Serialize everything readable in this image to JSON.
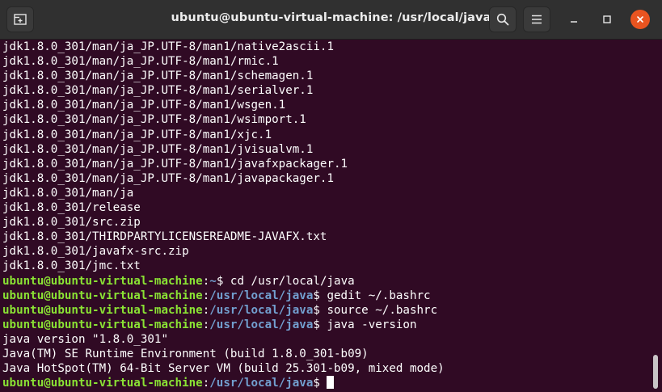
{
  "window": {
    "title": "ubuntu@ubuntu-virtual-machine: /usr/local/java"
  },
  "icons": {
    "new_tab": "new-tab-icon",
    "search": "search-icon",
    "menu": "hamburger-menu-icon",
    "minimize": "minimize-icon",
    "maximize": "maximize-icon",
    "close": "close-icon"
  },
  "colors": {
    "terminal_bg": "#300a24",
    "user_host": "#8ae234",
    "path": "#729fcf",
    "close_button": "#e95420"
  },
  "terminal": {
    "output_lines": [
      "jdk1.8.0_301/man/ja_JP.UTF-8/man1/native2ascii.1",
      "jdk1.8.0_301/man/ja_JP.UTF-8/man1/rmic.1",
      "jdk1.8.0_301/man/ja_JP.UTF-8/man1/schemagen.1",
      "jdk1.8.0_301/man/ja_JP.UTF-8/man1/serialver.1",
      "jdk1.8.0_301/man/ja_JP.UTF-8/man1/wsgen.1",
      "jdk1.8.0_301/man/ja_JP.UTF-8/man1/wsimport.1",
      "jdk1.8.0_301/man/ja_JP.UTF-8/man1/xjc.1",
      "jdk1.8.0_301/man/ja_JP.UTF-8/man1/jvisualvm.1",
      "jdk1.8.0_301/man/ja_JP.UTF-8/man1/javafxpackager.1",
      "jdk1.8.0_301/man/ja_JP.UTF-8/man1/javapackager.1",
      "jdk1.8.0_301/man/ja",
      "jdk1.8.0_301/release",
      "jdk1.8.0_301/src.zip",
      "jdk1.8.0_301/THIRDPARTYLICENSEREADME-JAVAFX.txt",
      "jdk1.8.0_301/javafx-src.zip",
      "jdk1.8.0_301/jmc.txt"
    ],
    "prompt_user": "ubuntu@ubuntu-virtual-machine",
    "commands": [
      {
        "path": "~",
        "cmd": " cd /usr/local/java"
      },
      {
        "path": "/usr/local/java",
        "cmd": " gedit ~/.bashrc"
      },
      {
        "path": "/usr/local/java",
        "cmd": " source ~/.bashrc"
      },
      {
        "path": "/usr/local/java",
        "cmd": " java -version"
      }
    ],
    "version_output": [
      "java version \"1.8.0_301\"",
      "Java(TM) SE Runtime Environment (build 1.8.0_301-b09)",
      "Java HotSpot(TM) 64-Bit Server VM (build 25.301-b09, mixed mode)"
    ],
    "final_prompt": {
      "path": "/usr/local/java",
      "cmd": " "
    }
  }
}
